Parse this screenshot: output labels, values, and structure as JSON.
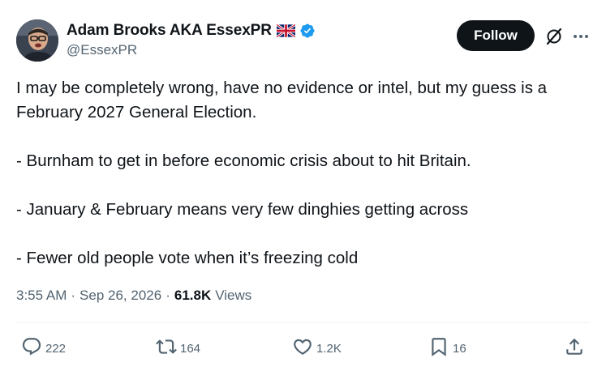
{
  "author": {
    "display_name": "Adam Brooks AKA EssexPR",
    "handle": "@EssexPR",
    "flag_icon": "uk-flag-icon",
    "verified_icon": "verified-badge-icon",
    "verified_color": "#1d9bf0"
  },
  "header": {
    "follow_label": "Follow",
    "grok_icon": "grok-icon",
    "more_icon": "more-icon"
  },
  "tweet": {
    "lines": [
      "I may be completely wrong, have no evidence or intel, but my guess is a February 2027 General Election.",
      "- Burnham to get in before economic crisis about to hit Britain.",
      "- January & February means very few dinghies getting across",
      "- Fewer old people vote when it’s freezing cold"
    ]
  },
  "meta": {
    "time": "3:55 AM",
    "date": "Sep 26, 2026",
    "views_count": "61.8K",
    "views_label": "Views"
  },
  "actions": {
    "replies": "222",
    "reposts": "164",
    "likes": "1.2K",
    "bookmarks": "16"
  },
  "colors": {
    "text": "#0f1419",
    "secondary": "#536471",
    "follow_bg": "#0f1419",
    "divider": "#eff3f4"
  }
}
